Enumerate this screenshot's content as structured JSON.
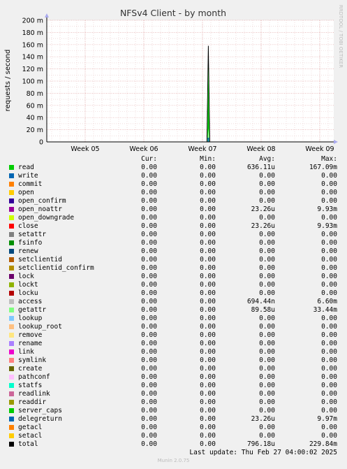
{
  "chart_data": {
    "type": "area",
    "title": "NFSv4 Client - by month",
    "ylabel": "requests / second",
    "side_label": "RRDTOOL / TOBI OETIKER",
    "ylim": [
      0,
      200
    ],
    "yticks": [
      "0",
      "20 m",
      "40 m",
      "60 m",
      "80 m",
      "100 m",
      "120 m",
      "140 m",
      "160 m",
      "180 m",
      "200 m"
    ],
    "yvals": [
      0,
      20,
      40,
      60,
      80,
      100,
      120,
      140,
      160,
      180,
      200
    ],
    "xticks": [
      "Week 05",
      "Week 06",
      "Week 07",
      "Week 08",
      "Week 09"
    ],
    "grid": true,
    "spike": {
      "week_position": 7.1,
      "series": [
        {
          "name": "total",
          "peak_mamp": 158,
          "color": "#000000"
        },
        {
          "name": "read",
          "peak_mamp": 125,
          "color": "#00cc00"
        },
        {
          "name": "getattr",
          "peak_mamp": 22,
          "color": "#99ff99"
        }
      ]
    }
  },
  "legend_header": {
    "cur": "Cur:",
    "min": "Min:",
    "avg": "Avg:",
    "max": "Max:"
  },
  "legend": [
    {
      "name": "read",
      "color": "#00cc00",
      "cur": "0.00",
      "min": "0.00",
      "avg": "636.11u",
      "max": "167.09m"
    },
    {
      "name": "write",
      "color": "#0066b3",
      "cur": "0.00",
      "min": "0.00",
      "avg": "0.00",
      "max": "0.00"
    },
    {
      "name": "commit",
      "color": "#ff8000",
      "cur": "0.00",
      "min": "0.00",
      "avg": "0.00",
      "max": "0.00"
    },
    {
      "name": "open",
      "color": "#ffcc00",
      "cur": "0.00",
      "min": "0.00",
      "avg": "0.00",
      "max": "0.00"
    },
    {
      "name": "open_confirm",
      "color": "#330099",
      "cur": "0.00",
      "min": "0.00",
      "avg": "0.00",
      "max": "0.00"
    },
    {
      "name": "open_noattr",
      "color": "#990099",
      "cur": "0.00",
      "min": "0.00",
      "avg": "23.26u",
      "max": "9.93m"
    },
    {
      "name": "open_downgrade",
      "color": "#ccff00",
      "cur": "0.00",
      "min": "0.00",
      "avg": "0.00",
      "max": "0.00"
    },
    {
      "name": "close",
      "color": "#ff0000",
      "cur": "0.00",
      "min": "0.00",
      "avg": "23.26u",
      "max": "9.93m"
    },
    {
      "name": "setattr",
      "color": "#808080",
      "cur": "0.00",
      "min": "0.00",
      "avg": "0.00",
      "max": "0.00"
    },
    {
      "name": "fsinfo",
      "color": "#008f00",
      "cur": "0.00",
      "min": "0.00",
      "avg": "0.00",
      "max": "0.00"
    },
    {
      "name": "renew",
      "color": "#00487d",
      "cur": "0.00",
      "min": "0.00",
      "avg": "0.00",
      "max": "0.00"
    },
    {
      "name": "setclientid",
      "color": "#b35a00",
      "cur": "0.00",
      "min": "0.00",
      "avg": "0.00",
      "max": "0.00"
    },
    {
      "name": "setclientid_confirm",
      "color": "#b38f00",
      "cur": "0.00",
      "min": "0.00",
      "avg": "0.00",
      "max": "0.00"
    },
    {
      "name": "lock",
      "color": "#6b006b",
      "cur": "0.00",
      "min": "0.00",
      "avg": "0.00",
      "max": "0.00"
    },
    {
      "name": "lockt",
      "color": "#8fb300",
      "cur": "0.00",
      "min": "0.00",
      "avg": "0.00",
      "max": "0.00"
    },
    {
      "name": "locku",
      "color": "#b30000",
      "cur": "0.00",
      "min": "0.00",
      "avg": "0.00",
      "max": "0.00"
    },
    {
      "name": "access",
      "color": "#bebebe",
      "cur": "0.00",
      "min": "0.00",
      "avg": "694.44n",
      "max": "6.60m"
    },
    {
      "name": "getattr",
      "color": "#80ff80",
      "cur": "0.00",
      "min": "0.00",
      "avg": "89.58u",
      "max": "33.44m"
    },
    {
      "name": "lookup",
      "color": "#80c9ff",
      "cur": "0.00",
      "min": "0.00",
      "avg": "0.00",
      "max": "0.00"
    },
    {
      "name": "lookup_root",
      "color": "#ffc080",
      "cur": "0.00",
      "min": "0.00",
      "avg": "0.00",
      "max": "0.00"
    },
    {
      "name": "remove",
      "color": "#ffe680",
      "cur": "0.00",
      "min": "0.00",
      "avg": "0.00",
      "max": "0.00"
    },
    {
      "name": "rename",
      "color": "#aa80ff",
      "cur": "0.00",
      "min": "0.00",
      "avg": "0.00",
      "max": "0.00"
    },
    {
      "name": "link",
      "color": "#ee00cc",
      "cur": "0.00",
      "min": "0.00",
      "avg": "0.00",
      "max": "0.00"
    },
    {
      "name": "symlink",
      "color": "#ff8080",
      "cur": "0.00",
      "min": "0.00",
      "avg": "0.00",
      "max": "0.00"
    },
    {
      "name": "create",
      "color": "#666600",
      "cur": "0.00",
      "min": "0.00",
      "avg": "0.00",
      "max": "0.00"
    },
    {
      "name": "pathconf",
      "color": "#ffbfff",
      "cur": "0.00",
      "min": "0.00",
      "avg": "0.00",
      "max": "0.00"
    },
    {
      "name": "statfs",
      "color": "#00ffcc",
      "cur": "0.00",
      "min": "0.00",
      "avg": "0.00",
      "max": "0.00"
    },
    {
      "name": "readlink",
      "color": "#cc6699",
      "cur": "0.00",
      "min": "0.00",
      "avg": "0.00",
      "max": "0.00"
    },
    {
      "name": "readdir",
      "color": "#999900",
      "cur": "0.00",
      "min": "0.00",
      "avg": "0.00",
      "max": "0.00"
    },
    {
      "name": "server_caps",
      "color": "#00cc00",
      "cur": "0.00",
      "min": "0.00",
      "avg": "0.00",
      "max": "0.00"
    },
    {
      "name": "delegreturn",
      "color": "#0066b3",
      "cur": "0.00",
      "min": "0.00",
      "avg": "23.26u",
      "max": "9.97m"
    },
    {
      "name": "getacl",
      "color": "#ff8000",
      "cur": "0.00",
      "min": "0.00",
      "avg": "0.00",
      "max": "0.00"
    },
    {
      "name": "setacl",
      "color": "#ffcc00",
      "cur": "0.00",
      "min": "0.00",
      "avg": "0.00",
      "max": "0.00"
    },
    {
      "name": "total",
      "color": "#000000",
      "cur": "0.00",
      "min": "0.00",
      "avg": "796.18u",
      "max": "229.84m"
    }
  ],
  "last_update": "Last update: Thu Feb 27 04:00:02 2025",
  "version": "Munin 2.0.75"
}
